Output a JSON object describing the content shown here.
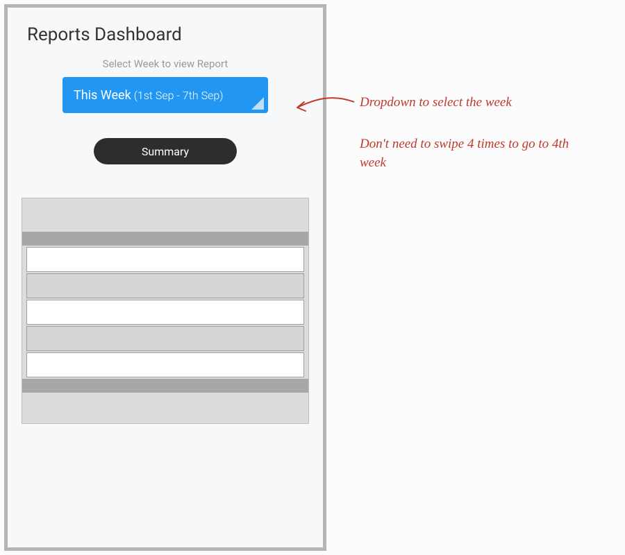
{
  "header": {
    "title": "Reports Dashboard"
  },
  "selector": {
    "label": "Select Week to view Report",
    "selected_main": "This Week",
    "selected_range": "(1st Sep - 7th Sep)"
  },
  "summary_button": {
    "label": "Summary"
  },
  "annotations": {
    "dropdown_note": "Dropdown to select the week",
    "swipe_note": "Don't need to swipe 4 times to go to 4th week"
  },
  "colors": {
    "accent": "#2196f3",
    "chip": "#2d2d2d",
    "annotation": "#c0392b",
    "frame_border": "#b5b5b5"
  }
}
